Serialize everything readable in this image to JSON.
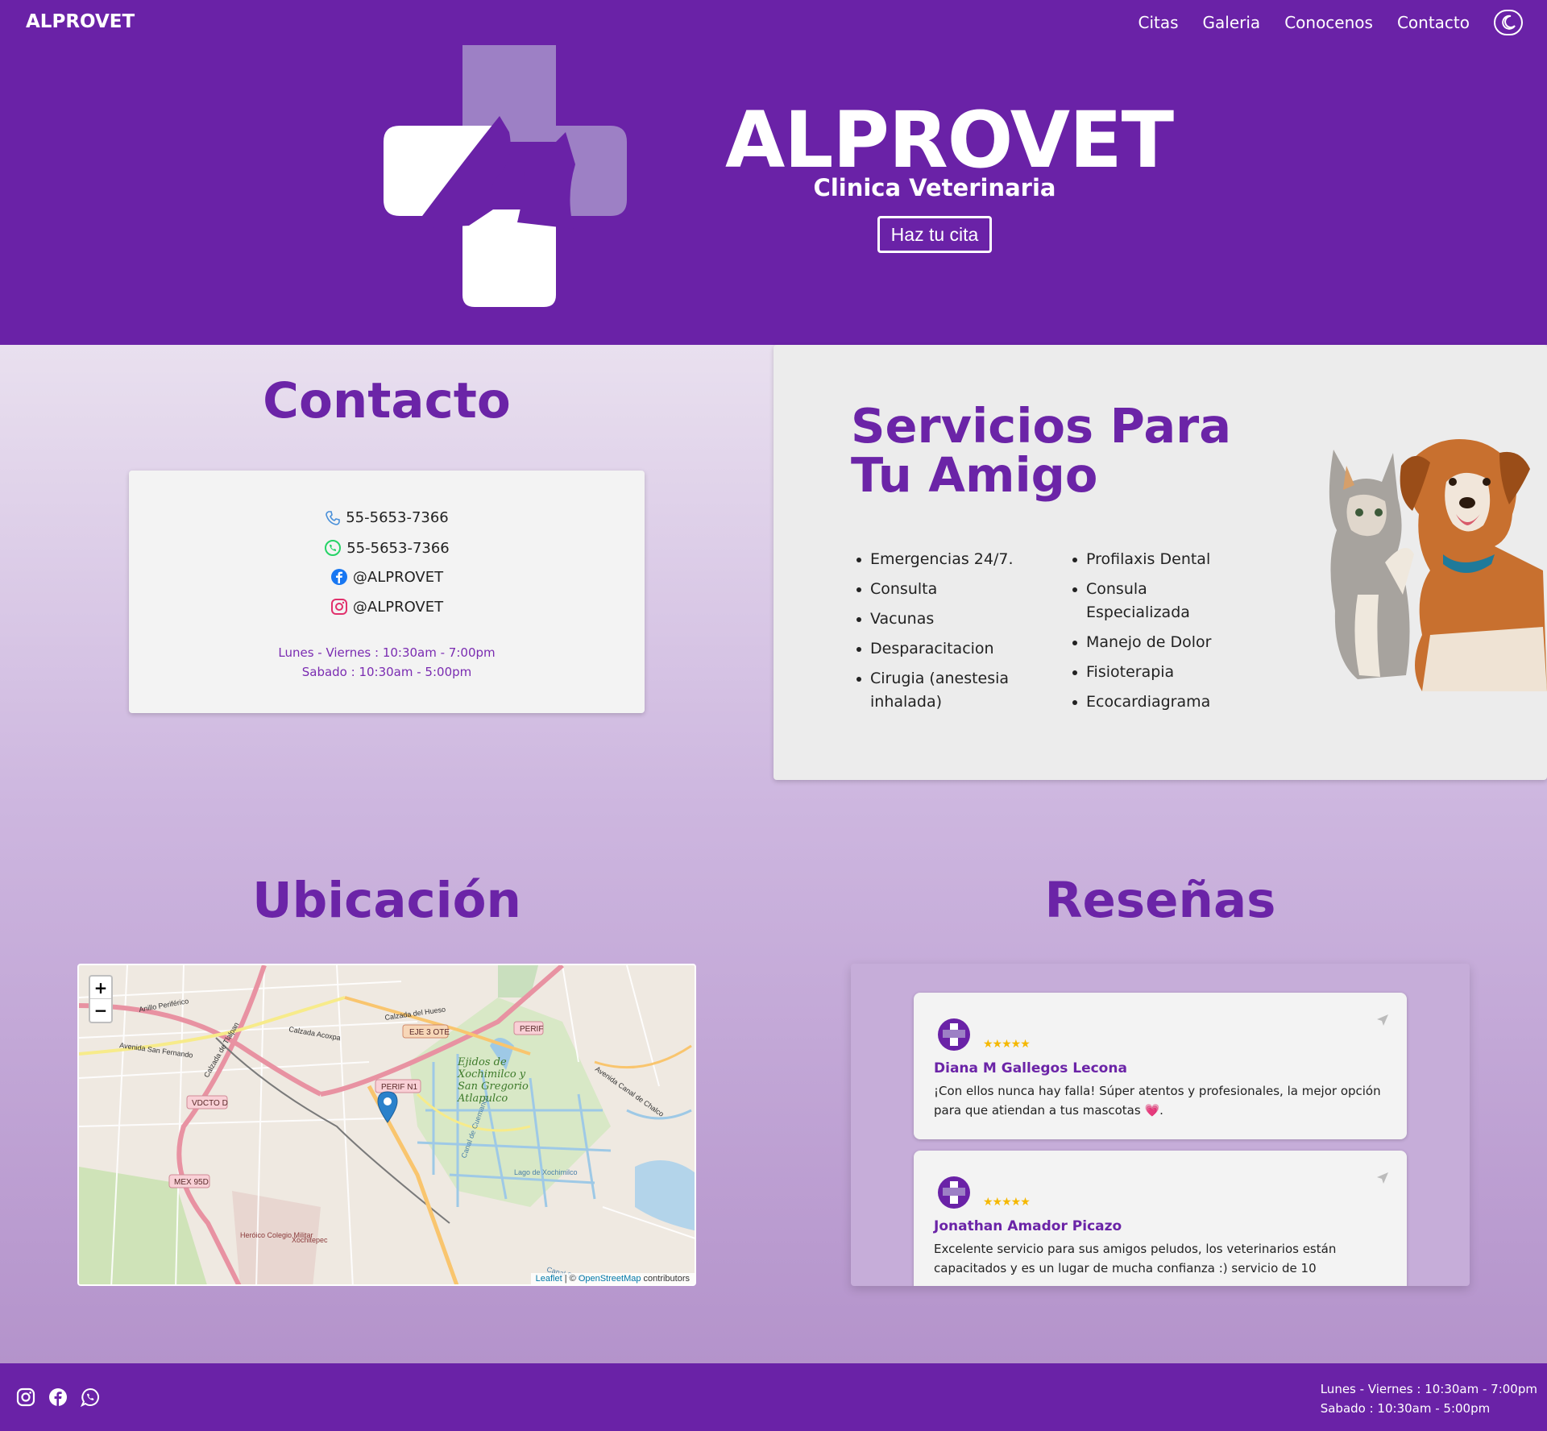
{
  "nav": {
    "brand": "ALPROVET",
    "links": [
      "Citas",
      "Galeria",
      "Conocenos",
      "Contacto"
    ],
    "theme_icon": "moon-icon"
  },
  "hero": {
    "title": "ALPROVET",
    "subtitle": "Clinica Veterinaria",
    "cta": "Haz tu cita"
  },
  "contact": {
    "title": "Contacto",
    "phone": "55-5653-7366",
    "whatsapp": "55-5653-7366",
    "facebook": "@ALPROVET",
    "instagram": "@ALPROVET",
    "hours_weekday": "Lunes - Viernes : 10:30am - 7:00pm",
    "hours_saturday": "Sabado : 10:30am - 5:00pm"
  },
  "services": {
    "title": "Servicios Para Tu Amigo",
    "col1": [
      "Emergencias 24/7.",
      "Consulta",
      "Vacunas",
      "Desparacitacion",
      "Cirugia (anestesia inhalada)"
    ],
    "col2": [
      "Profilaxis Dental",
      "Consula Especializada",
      "Manejo de Dolor",
      "Fisioterapia",
      "Ecocardiagrama"
    ]
  },
  "location": {
    "title": "Ubicación",
    "zoom_in": "+",
    "zoom_out": "−",
    "attrib_leaflet": "Leaflet",
    "attrib_sep": " | © ",
    "attrib_osm": "OpenStreetMap",
    "attrib_tail": " contributors",
    "map_labels": {
      "anillo": "Anillo Periférico",
      "calzada": "Calzada del Hueso",
      "acoxpa": "Calzada Acoxpa",
      "tlalpan": "Calzada de Tlalpan",
      "san_fernando": "Avenida San Fernando",
      "eje3": "EJE 3 OTE",
      "perif": "PERIF",
      "perif_n1": "PERIF N1",
      "vdcto": "VDCTO D",
      "mex95": "MEX 95D",
      "ejidos": "Ejidos de Xochimilco y San Gregorio Atlapulco",
      "colegio": "Heróico Colegio Militar",
      "xochitepec": "Xochitepec",
      "lago": "Lago de Xochimilco",
      "canal_cuemanco": "Canal de Cuemanco",
      "canal_santa": "Canal Santa",
      "av_chalco": "Avenida Canal de Chalco"
    }
  },
  "reviews": {
    "title": "Reseñas",
    "items": [
      {
        "name": "Diana M Gallegos Lecona",
        "stars": "★★★★★",
        "text": "¡Con ellos nunca hay falla! Súper atentos y profesionales, la mejor opción para que atiendan a tus mascotas 💗."
      },
      {
        "name": "Jonathan Amador Picazo",
        "stars": "★★★★★",
        "text": "Excelente servicio para sus amigos peludos, los veterinarios están capacitados y es un lugar de mucha confianza :) servicio de 10"
      }
    ]
  },
  "footer": {
    "hours_weekday": "Lunes - Viernes : 10:30am - 7:00pm",
    "hours_saturday": "Sabado : 10:30am - 5:00pm",
    "icons": [
      "instagram-icon",
      "facebook-icon",
      "whatsapp-icon"
    ]
  },
  "colors": {
    "brand_purple": "#6a22a7",
    "title_purple": "#6b24a7",
    "logo_light": "#9d80c5"
  }
}
